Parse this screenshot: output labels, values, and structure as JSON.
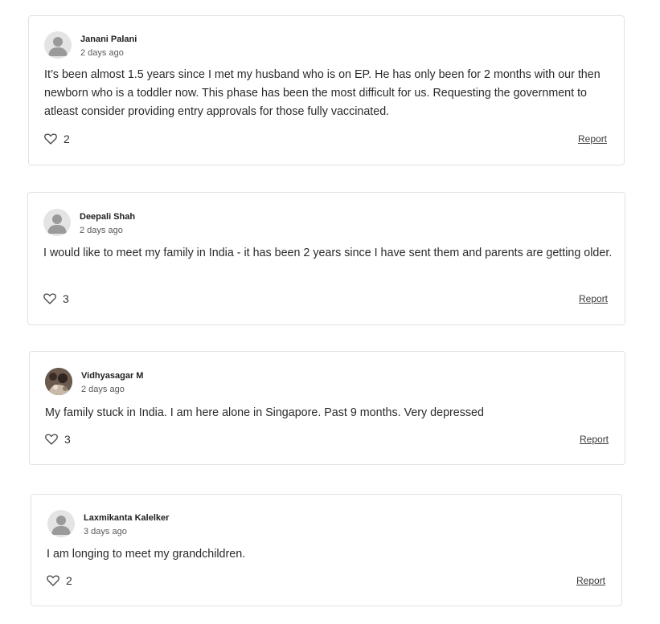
{
  "comments": [
    {
      "author": "Janani Palani",
      "date": "2 days ago",
      "text": "It’s been almost 1.5 years since I met my husband who is on EP. He has only been for 2 months with our then newborn who is a toddler now. This phase has been the most difficult for us. Requesting the government to atleast consider providing entry approvals for those fully vaccinated.",
      "likes": "2",
      "report": "Report",
      "avatar": "default-user-icon"
    },
    {
      "author": "Deepali Shah",
      "date": "2 days ago",
      "text": "I would like to meet my family in India - it has been 2 years since I have sent them and parents are getting older.",
      "likes": "3",
      "report": "Report",
      "avatar": "default-user-icon"
    },
    {
      "author": "Vidhyasagar M",
      "date": "2 days ago",
      "text": "My family stuck in India. I am here alone in Singapore. Past 9 months. Very depressed",
      "likes": "3",
      "report": "Report",
      "avatar": "profile-photo"
    },
    {
      "author": "Laxmikanta Kalelker",
      "date": "3 days ago",
      "text": "I am longing to meet my grandchildren.",
      "likes": "2",
      "report": "Report",
      "avatar": "default-user-icon"
    }
  ],
  "colors": {
    "border": "#e2e2e2",
    "text": "#2a2a2a",
    "avatar_bg": "#e4e4e4",
    "avatar_fg": "#9a9a9a"
  }
}
